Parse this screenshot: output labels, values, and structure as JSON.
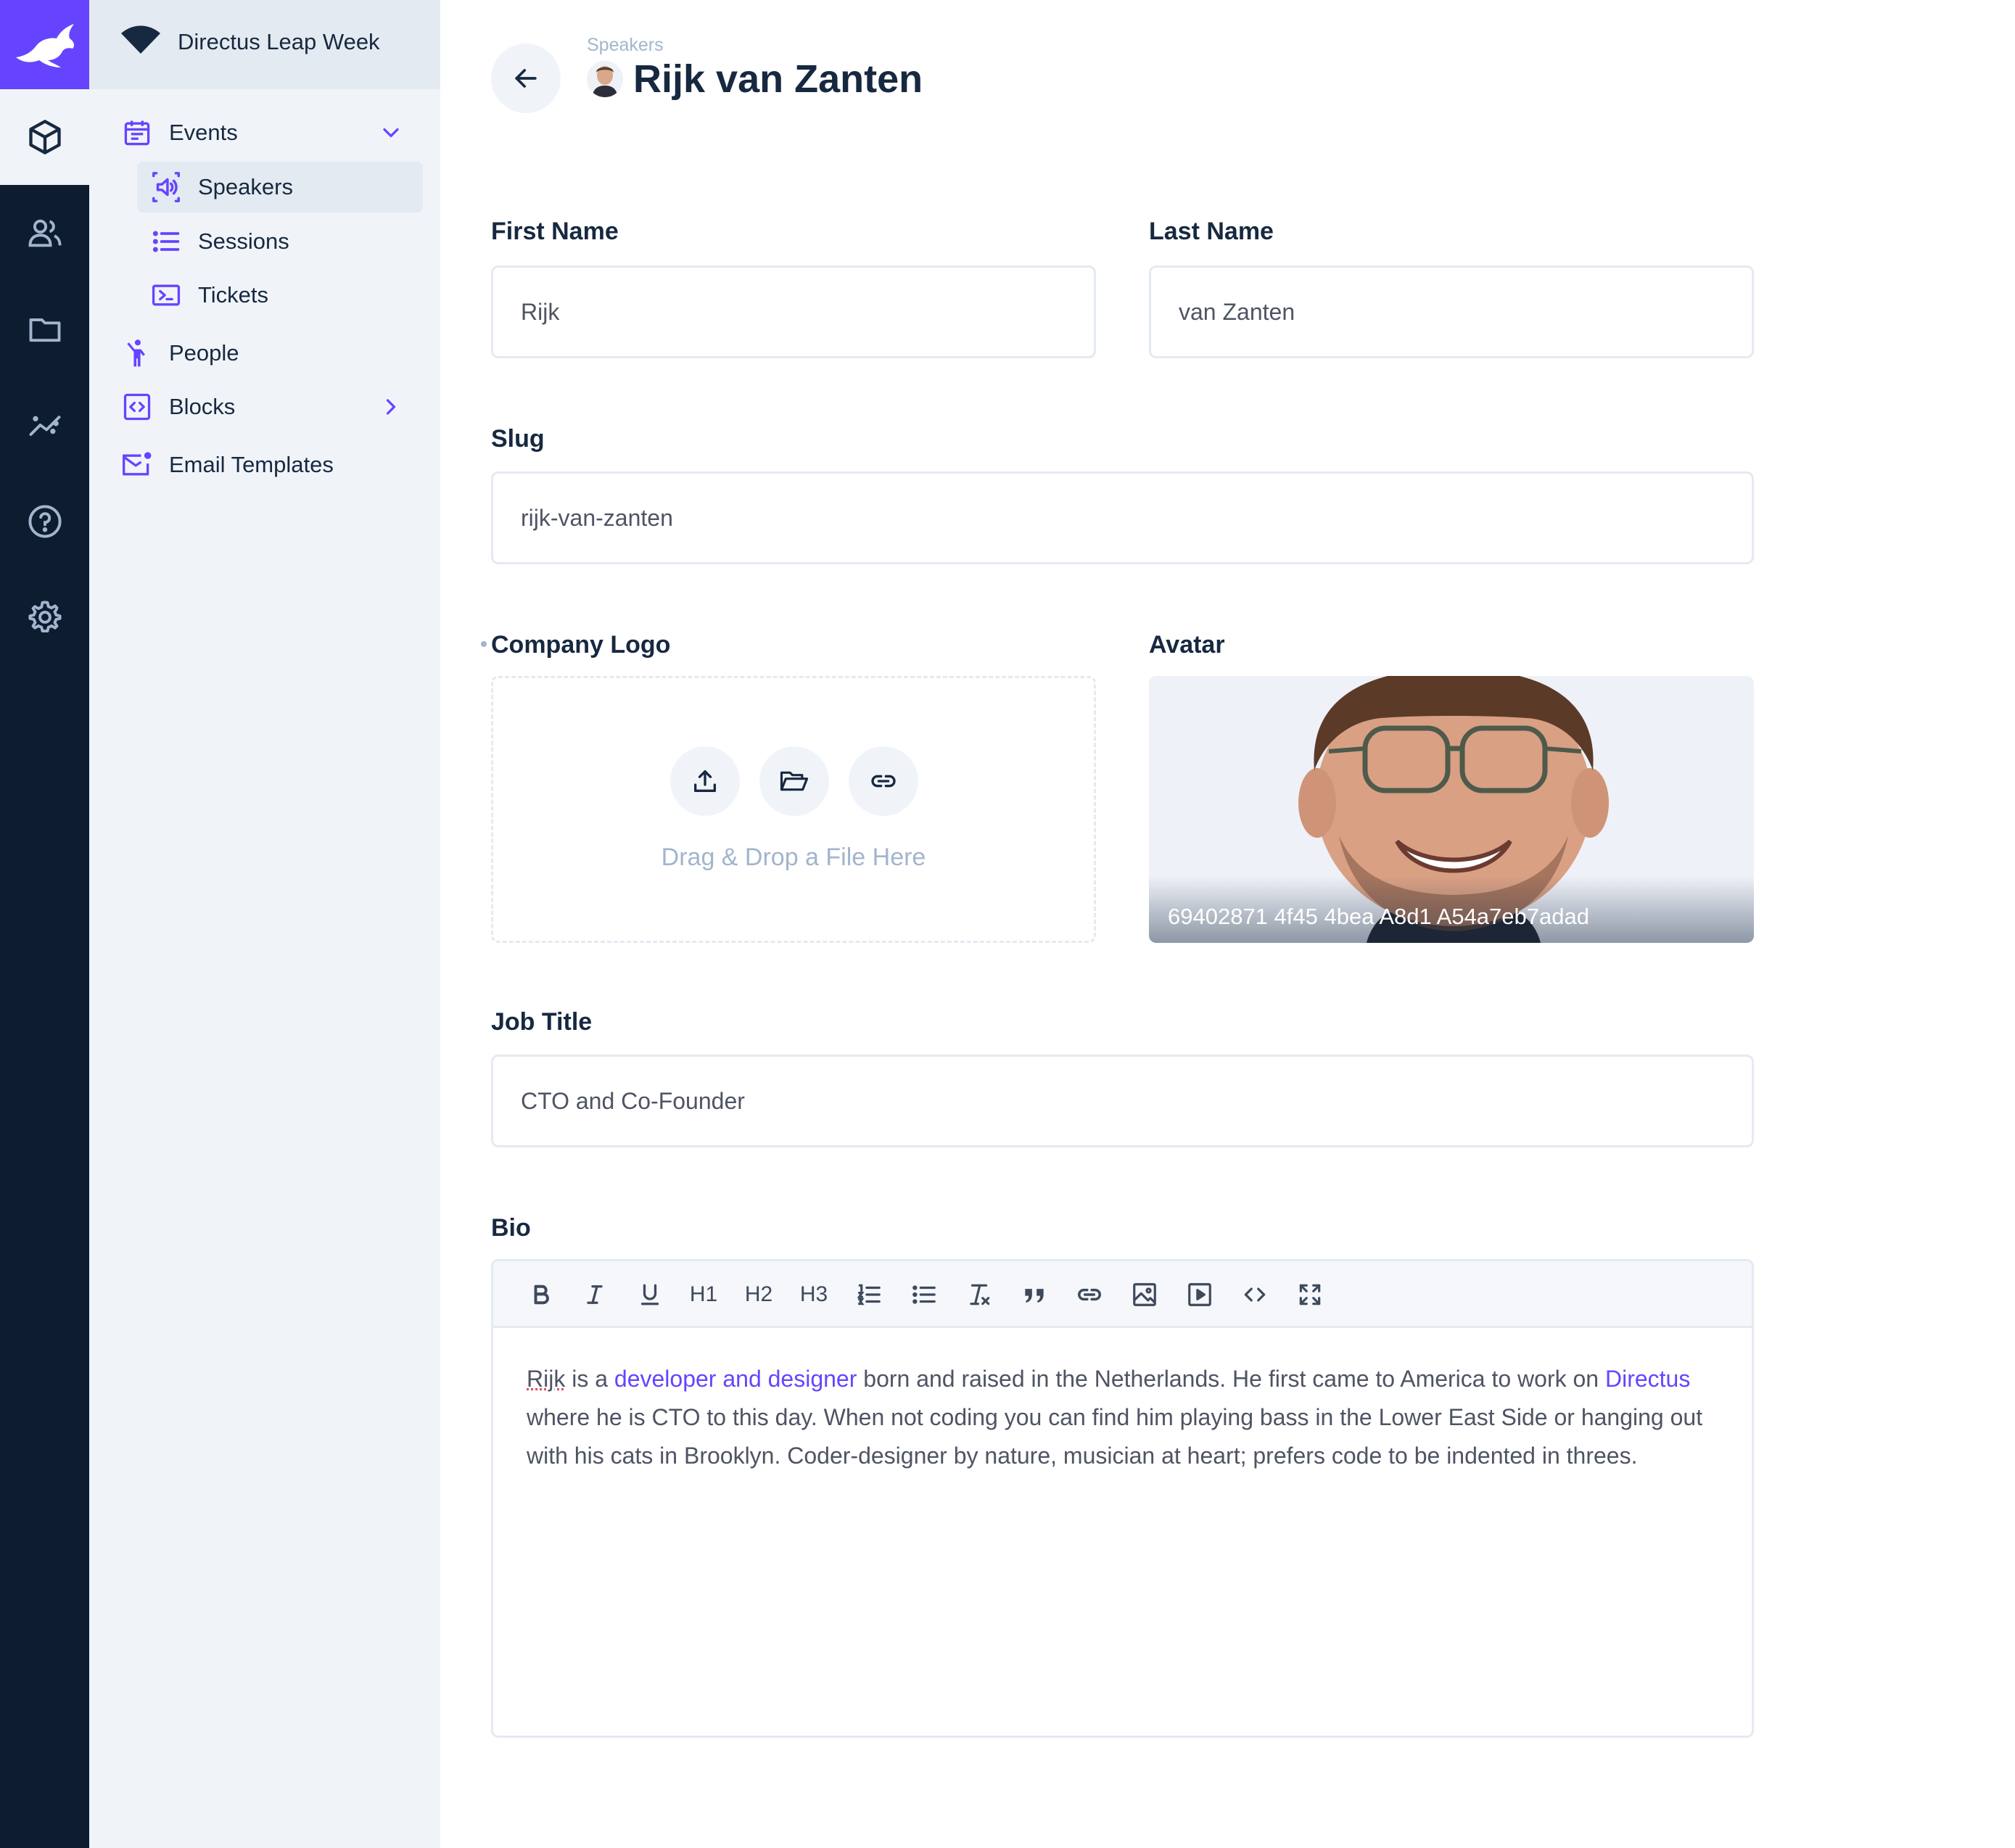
{
  "project": {
    "name": "Directus Leap Week"
  },
  "colors": {
    "accent": "#6644ff",
    "rail": "#0e1c2f",
    "nav_bg": "#f0f4f9",
    "text": "#172940",
    "muted": "#a2b5cd"
  },
  "rail": {
    "items": [
      {
        "name": "content",
        "icon": "cube-icon",
        "active": true
      },
      {
        "name": "users",
        "icon": "users-icon"
      },
      {
        "name": "files",
        "icon": "folder-icon"
      },
      {
        "name": "insights",
        "icon": "insights-icon"
      },
      {
        "name": "help",
        "icon": "help-icon"
      },
      {
        "name": "settings",
        "icon": "gear-icon"
      }
    ]
  },
  "nav": {
    "items": [
      {
        "label": "Events",
        "icon": "calendar-icon",
        "expanded": true
      },
      {
        "label": "Speakers",
        "icon": "speaker-icon",
        "active": true
      },
      {
        "label": "Sessions",
        "icon": "list-icon"
      },
      {
        "label": "Tickets",
        "icon": "ticket-icon"
      },
      {
        "label": "People",
        "icon": "person-icon"
      },
      {
        "label": "Blocks",
        "icon": "code-block-icon",
        "expandable": true
      },
      {
        "label": "Email Templates",
        "icon": "mail-icon"
      }
    ]
  },
  "header": {
    "breadcrumb": "Speakers",
    "title": "Rijk van Zanten"
  },
  "form": {
    "first_name": {
      "label": "First Name",
      "value": "Rijk"
    },
    "last_name": {
      "label": "Last Name",
      "value": "van Zanten"
    },
    "slug": {
      "label": "Slug",
      "value": "rijk-van-zanten"
    },
    "company_logo": {
      "label": "Company Logo",
      "dropzone_text": "Drag & Drop a File Here"
    },
    "avatar": {
      "label": "Avatar",
      "caption": "69402871 4f45 4bea A8d1 A54a7eb7adad"
    },
    "job_title": {
      "label": "Job Title",
      "value": "CTO and Co-Founder"
    },
    "bio": {
      "label": "Bio",
      "toolbar": {
        "h1": "H1",
        "h2": "H2",
        "h3": "H3"
      },
      "parts": {
        "p1": "Rijk",
        "p2": " is a ",
        "link1": "developer and designer",
        "p3": " born and raised in the Netherlands. He first came to America to work on ",
        "link2": "Directus",
        "p4": " where he is CTO to this day. When not coding you can find him playing bass in the Lower East Side or hanging out with his cats in Brooklyn. Coder-designer by nature, musician at heart; prefers code to be indented in threes."
      }
    }
  }
}
